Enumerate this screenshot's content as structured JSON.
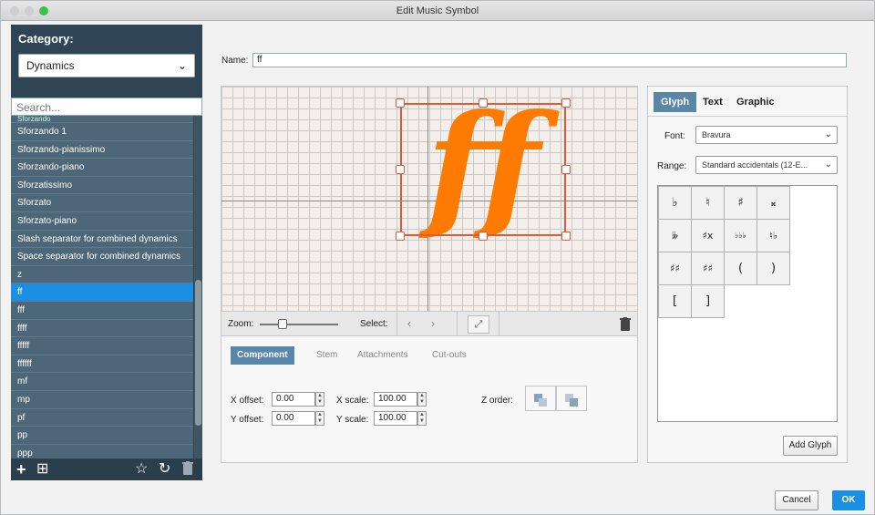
{
  "window": {
    "title": "Edit Music Symbol"
  },
  "sidebar": {
    "category_label": "Category:",
    "category_value": "Dynamics",
    "search_placeholder": "Search...",
    "partial_item": "Sforzando",
    "items": [
      "Sforzando 1",
      "Sforzando-pianissimo",
      "Sforzando-piano",
      "Sforzatissimo",
      "Sforzato",
      "Sforzato-piano",
      "Slash separator for combined dynamics",
      "Space separator for combined dynamics",
      "z",
      "ff",
      "fff",
      "ffff",
      "fffff",
      "ffffff",
      "mf",
      "mp",
      "pf",
      "pp",
      "ppp"
    ],
    "selected_index": 9,
    "icons": {
      "add": "+",
      "add_table": "⊞",
      "star": "☆",
      "revert": "↻",
      "trash": "🗑"
    }
  },
  "name": {
    "label": "Name:",
    "value": "ff"
  },
  "editor": {
    "glyph_text": "ff",
    "glyph_color": "#ff7a00",
    "selection_color": "#e05a3a",
    "zoom_label": "Zoom:",
    "select_label": "Select:",
    "prev_arrow": "‹",
    "next_arrow": "›",
    "tabs": [
      "Component",
      "Stem",
      "Attachments",
      "Cut-outs"
    ],
    "active_tab": "Component",
    "x_offset_label": "X offset:",
    "x_offset": "0.00",
    "y_offset_label": "Y offset:",
    "y_offset": "0.00",
    "x_scale_label": "X scale:",
    "x_scale": "100.00",
    "y_scale_label": "Y scale:",
    "y_scale": "100.00",
    "z_order_label": "Z order:"
  },
  "right_panel": {
    "tabs": [
      "Glyph",
      "Text",
      "Graphic"
    ],
    "active_tab": "Glyph",
    "font_label": "Font:",
    "font_value": "Bravura",
    "range_label": "Range:",
    "range_value": "Standard accidentals (12-E...",
    "glyphs": [
      "♭",
      "♮",
      "♯",
      "𝄪",
      "𝄫",
      "♯x",
      "♭♭♭",
      "♮♭",
      "♯♯",
      "♯♯",
      "(",
      ")",
      "[",
      "]"
    ],
    "add_glyph": "Add Glyph"
  },
  "footer": {
    "cancel": "Cancel",
    "ok": "OK"
  },
  "colors": {
    "accent": "#1a8fe3",
    "sidebar": "#2f4555",
    "tab_active": "#5a86a8"
  }
}
